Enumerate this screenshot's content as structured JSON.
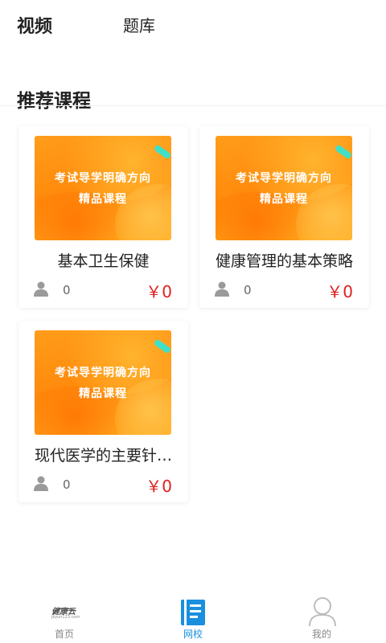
{
  "top_tabs": [
    {
      "label": "视频"
    },
    {
      "label": "题库"
    }
  ],
  "section_title": "推荐课程",
  "thumbnail": {
    "line1": "考试导学明确方向",
    "line2": "精品课程"
  },
  "courses": [
    {
      "name": "基本卫生保健",
      "count": "0",
      "price": "￥0"
    },
    {
      "name": "健康管理的基本策略",
      "count": "0",
      "price": "￥0"
    },
    {
      "name": "现代医学的主要针…",
      "count": "0",
      "price": "￥0"
    }
  ],
  "bottom_nav": {
    "home": {
      "logo": "健康云",
      "logo_sub": "jkyun123.com",
      "label": "首页"
    },
    "school": {
      "label": "网校"
    },
    "mine": {
      "label": "我的"
    }
  },
  "colors": {
    "accent": "#1a8fe0",
    "price": "#e02020",
    "thumb_orange": "#ff9d1a"
  },
  "icons": [
    "person-icon",
    "school-icon",
    "user-icon",
    "brand-logo"
  ]
}
